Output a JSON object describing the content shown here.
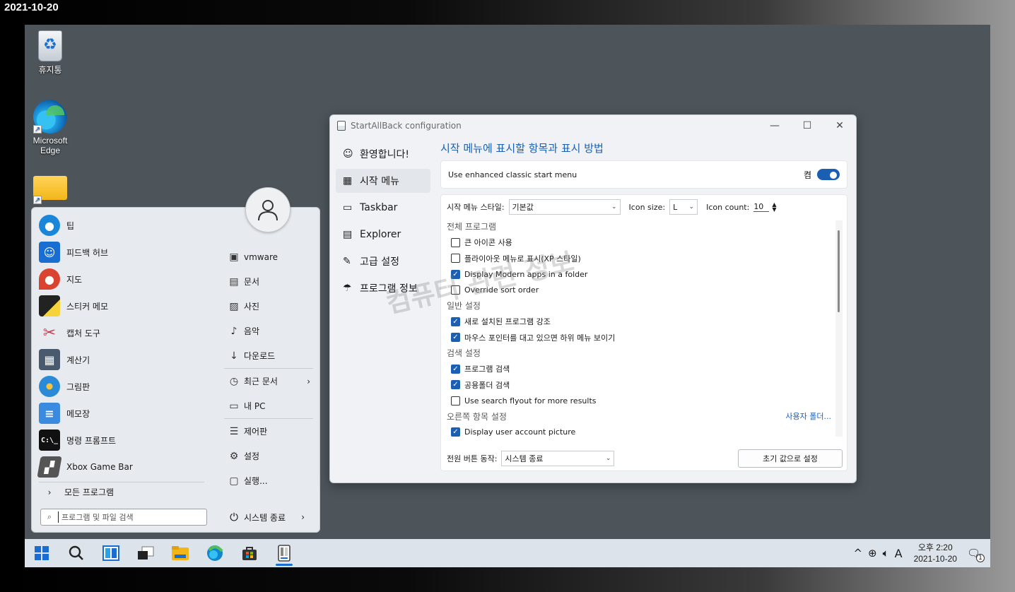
{
  "outer_date": "2021-10-20",
  "desktop": {
    "icons": [
      {
        "label": "휴지통",
        "icon": "recycle-bin-icon"
      },
      {
        "label": "Microsoft Edge",
        "icon": "edge-icon"
      },
      {
        "label": "",
        "icon": "folder-icon"
      }
    ]
  },
  "start_menu": {
    "left_items": [
      {
        "label": "팁",
        "icon": "tips-icon",
        "color": "#1a86d9"
      },
      {
        "label": "피드백 허브",
        "icon": "feedback-hub-icon",
        "color": "#1a6ed2"
      },
      {
        "label": "지도",
        "icon": "maps-icon",
        "color": "#d9432f"
      },
      {
        "label": "스티커 메모",
        "icon": "sticky-notes-icon",
        "color": "#222222"
      },
      {
        "label": "캡처 도구",
        "icon": "snipping-tool-icon",
        "color": "#c83c50"
      },
      {
        "label": "계산기",
        "icon": "calculator-icon",
        "color": "#4a5a6e"
      },
      {
        "label": "그림판",
        "icon": "paint-icon",
        "color": "#2a8ad8"
      },
      {
        "label": "메모장",
        "icon": "notepad-icon",
        "color": "#3a8ae0"
      },
      {
        "label": "명령 프롬프트",
        "icon": "command-prompt-icon",
        "color": "#111111"
      },
      {
        "label": "Xbox Game Bar",
        "icon": "xbox-game-bar-icon",
        "color": "#555555"
      }
    ],
    "all_programs": "모든 프로그램",
    "right_items": [
      {
        "label": "vmware",
        "icon": "user-folder-icon",
        "glyph": "▣"
      },
      {
        "label": "문서",
        "icon": "documents-icon",
        "glyph": "▤"
      },
      {
        "label": "사진",
        "icon": "pictures-icon",
        "glyph": "▨"
      },
      {
        "label": "음악",
        "icon": "music-icon",
        "glyph": "♪"
      },
      {
        "label": "다운로드",
        "icon": "downloads-icon",
        "glyph": "↓"
      }
    ],
    "right_items2": [
      {
        "label": "최근 문서",
        "icon": "recent-documents-icon",
        "glyph": "◷",
        "arrow": "›"
      },
      {
        "label": "내 PC",
        "icon": "this-pc-icon",
        "glyph": "▭",
        "arrow": ""
      }
    ],
    "right_items3": [
      {
        "label": "제어판",
        "icon": "control-panel-icon",
        "glyph": "☰"
      },
      {
        "label": "설정",
        "icon": "settings-icon",
        "glyph": "⚙"
      },
      {
        "label": "실행...",
        "icon": "run-icon",
        "glyph": "▢"
      }
    ],
    "search_placeholder": "프로그램 및 파일 검색",
    "shutdown_label": "시스템 종료"
  },
  "window": {
    "title": "StartAllBack configuration",
    "nav": [
      {
        "label": "환영합니다!",
        "icon": "smile-icon",
        "glyph": "☺"
      },
      {
        "label": "시작 메뉴",
        "icon": "start-menu-icon",
        "glyph": "▦"
      },
      {
        "label": "Taskbar",
        "icon": "taskbar-icon",
        "glyph": "▭"
      },
      {
        "label": "Explorer",
        "icon": "explorer-icon",
        "glyph": "▤"
      },
      {
        "label": "고급 설정",
        "icon": "wrench-icon",
        "glyph": "✎"
      },
      {
        "label": "프로그램 정보",
        "icon": "info-icon",
        "glyph": "☂"
      }
    ],
    "heading": "시작 메뉴에 표시할 항목과 표시 방법",
    "enhanced_label": "Use enhanced classic start menu",
    "toggle_state_label": "켬",
    "style_label": "시작 메뉴 스타일:",
    "style_value": "기본값",
    "icon_size_label": "Icon size:",
    "icon_size_value": "L",
    "icon_count_label": "Icon count:",
    "icon_count_value": "10",
    "sections": [
      {
        "title": "전체 프로그램",
        "items": [
          {
            "label": "큰 아이콘 사용",
            "checked": false
          },
          {
            "label": "플라이아웃 메뉴로 표시(XP 스타일)",
            "checked": false
          },
          {
            "label": "Display Modern apps in a folder",
            "checked": true
          },
          {
            "label": "Override sort order",
            "checked": false
          }
        ]
      },
      {
        "title": "일반 설정",
        "items": [
          {
            "label": "새로 설치된 프로그램 강조",
            "checked": true
          },
          {
            "label": "마우스 포인터를 대고 있으면 하위 메뉴 보이기",
            "checked": true
          }
        ]
      },
      {
        "title": "검색 설정",
        "items": [
          {
            "label": "프로그램 검색",
            "checked": true
          },
          {
            "label": "공용폴더 검색",
            "checked": true
          },
          {
            "label": "Use search flyout for more results",
            "checked": false
          }
        ]
      },
      {
        "title": "오른쪽 항목 설정",
        "link": "사용자 폴더...",
        "items": [
          {
            "label": "Display user account picture",
            "checked": true
          }
        ]
      }
    ],
    "power_label": "전원 버튼 동작:",
    "power_value": "시스템 종료",
    "reset_label": "초기 값으로 설정"
  },
  "watermark": "컴퓨터 관련 정보",
  "taskbar": {
    "icons": [
      "start-icon",
      "search-icon",
      "widgets-icon",
      "task-view-icon",
      "file-explorer-icon",
      "edge-icon",
      "store-icon",
      "startallback-icon"
    ],
    "tray": {
      "lang": "A",
      "time": "오후 2:20",
      "date": "2021-10-20",
      "notif_count": "1"
    }
  }
}
